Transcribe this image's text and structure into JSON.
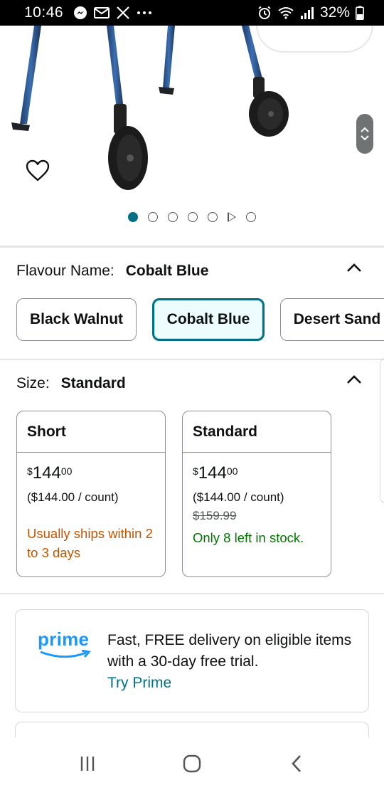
{
  "status_bar": {
    "time": "10:46",
    "battery": "32%"
  },
  "gallery": {
    "dot_count": 7,
    "active_index": 0
  },
  "flavour": {
    "label": "Flavour Name:",
    "selected": "Cobalt Blue",
    "options": [
      "Black Walnut",
      "Cobalt Blue",
      "Desert Sand"
    ]
  },
  "size": {
    "label": "Size:",
    "selected": "Standard",
    "options": [
      {
        "name": "Short",
        "price_currency": "$",
        "price_whole": "144",
        "price_fraction": "00",
        "unit_price": "($144.00 / count)",
        "list_price": "",
        "availability": "Usually ships within 2 to 3 days",
        "availability_color": "#c45500"
      },
      {
        "name": "Standard",
        "price_currency": "$",
        "price_whole": "144",
        "price_fraction": "00",
        "unit_price": "($144.00 / count)",
        "list_price": "$159.99",
        "availability": "Only 8 left in stock.",
        "availability_color": "#007600"
      }
    ]
  },
  "prime": {
    "logo": "prime",
    "text": "Fast, FREE delivery on eligible items with a 30-day free trial.",
    "link": "Try Prime"
  },
  "colors": {
    "accent": "#007185",
    "prime_blue": "#1a98ff"
  }
}
